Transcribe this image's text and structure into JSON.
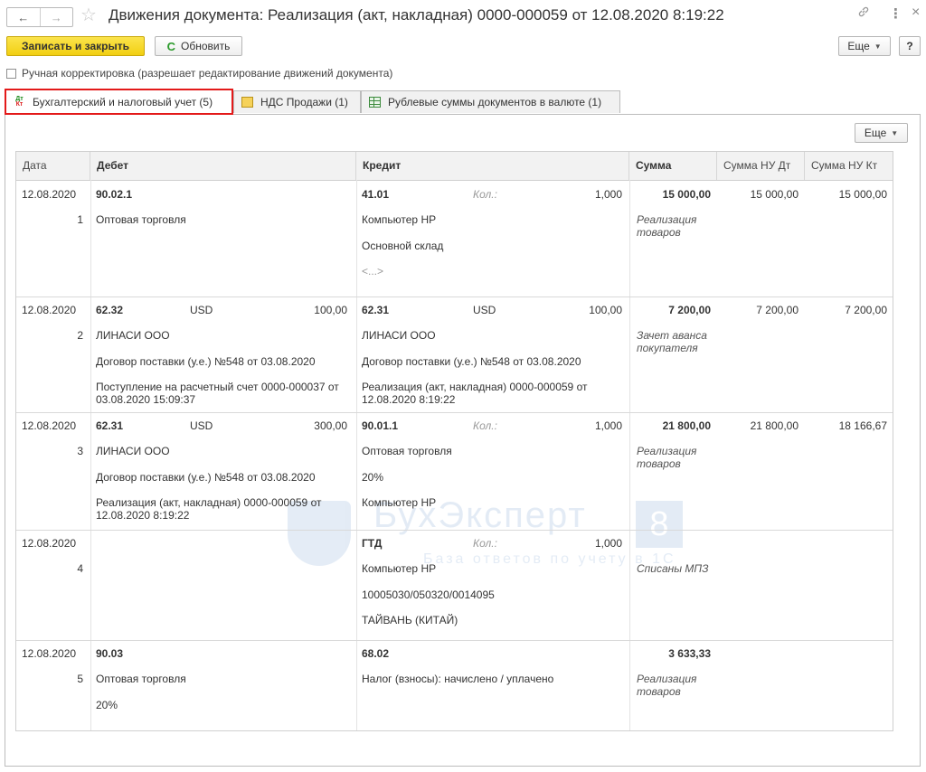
{
  "window": {
    "title": "Движения документа: Реализация (акт, накладная) 0000-000059 от 12.08.2020 8:19:22",
    "back_glyph": "←",
    "forward_glyph": "→",
    "star_glyph": "☆",
    "link_glyph": "🔗",
    "more_glyph": "⋮",
    "close_glyph": "×"
  },
  "toolbar": {
    "save_close_label": "Записать и закрыть",
    "refresh_label": "Обновить",
    "refresh_glyph": "C",
    "more_label": "Еще",
    "help_label": "?",
    "caret": "▼"
  },
  "manual_edit": {
    "label": "Ручная корректировка (разрешает редактирование движений документа)",
    "checked": false
  },
  "tabs": [
    {
      "label": "Бухгалтерский и налоговый учет (5)",
      "icon": "dt-kt-icon",
      "active": true
    },
    {
      "label": "НДС Продажи (1)",
      "icon": "vat-register-icon",
      "active": false
    },
    {
      "label": "Рублевые суммы документов в валюте (1)",
      "icon": "grid-icon",
      "active": false
    }
  ],
  "tab_icon_text": {
    "top": "Дт",
    "bottom": "Кт"
  },
  "table_more_label": "Еще",
  "columns": {
    "date": "Дата",
    "debet": "Дебет",
    "kredit": "Кредит",
    "sum": "Сумма",
    "nu_dt": "Сумма НУ Дт",
    "nu_kt": "Сумма НУ Кт"
  },
  "rows": [
    {
      "date": "12.08.2020",
      "num": "1",
      "debet_account": "90.02.1",
      "debet_currency": "",
      "debet_amount": "",
      "debet_lines": [
        "Оптовая торговля",
        "",
        ""
      ],
      "kredit_account": "41.01",
      "kredit_qty_label": "Кол.:",
      "kredit_qty": "1,000",
      "kredit_currency": "",
      "kredit_amount": "",
      "kredit_lines": [
        "Компьютер HP",
        "Основной склад",
        "<...>"
      ],
      "sum": "15 000,00",
      "content": "Реализация товаров",
      "nu_dt": "15 000,00",
      "nu_kt": "15 000,00"
    },
    {
      "date": "12.08.2020",
      "num": "2",
      "debet_account": "62.32",
      "debet_currency": "USD",
      "debet_amount": "100,00",
      "debet_lines": [
        "ЛИНАСИ ООО",
        "Договор поставки (у.е.) №548 от 03.08.2020",
        "Поступление на расчетный счет 0000-000037 от 03.08.2020 15:09:37"
      ],
      "kredit_account": "62.31",
      "kredit_qty_label": "",
      "kredit_qty": "",
      "kredit_currency": "USD",
      "kredit_amount": "100,00",
      "kredit_lines": [
        "ЛИНАСИ ООО",
        "Договор поставки (у.е.) №548 от 03.08.2020",
        "Реализация (акт, накладная) 0000-000059 от 12.08.2020 8:19:22"
      ],
      "sum": "7 200,00",
      "content": "Зачет аванса покупателя",
      "nu_dt": "7 200,00",
      "nu_kt": "7 200,00"
    },
    {
      "date": "12.08.2020",
      "num": "3",
      "debet_account": "62.31",
      "debet_currency": "USD",
      "debet_amount": "300,00",
      "debet_lines": [
        "ЛИНАСИ ООО",
        "Договор поставки (у.е.) №548 от 03.08.2020",
        "Реализация (акт, накладная) 0000-000059 от 12.08.2020 8:19:22"
      ],
      "kredit_account": "90.01.1",
      "kredit_qty_label": "Кол.:",
      "kredit_qty": "1,000",
      "kredit_currency": "",
      "kredit_amount": "",
      "kredit_lines": [
        "Оптовая торговля",
        "20%",
        "Компьютер HP"
      ],
      "sum": "21 800,00",
      "content": "Реализация товаров",
      "nu_dt": "21 800,00",
      "nu_kt": "18 166,67"
    },
    {
      "date": "12.08.2020",
      "num": "4",
      "debet_account": "",
      "debet_currency": "",
      "debet_amount": "",
      "debet_lines": [
        "",
        "",
        ""
      ],
      "kredit_account": "ГТД",
      "kredit_qty_label": "Кол.:",
      "kredit_qty": "1,000",
      "kredit_currency": "",
      "kredit_amount": "",
      "kredit_lines": [
        "Компьютер HP",
        "10005030/050320/0014095",
        "ТАЙВАНЬ (КИТАЙ)"
      ],
      "sum": "",
      "content": "Списаны МПЗ",
      "nu_dt": "",
      "nu_kt": ""
    },
    {
      "date": "12.08.2020",
      "num": "5",
      "debet_account": "90.03",
      "debet_currency": "",
      "debet_amount": "",
      "debet_lines": [
        "Оптовая торговля",
        "20%",
        ""
      ],
      "kredit_account": "68.02",
      "kredit_qty_label": "",
      "kredit_qty": "",
      "kredit_currency": "",
      "kredit_amount": "",
      "kredit_lines": [
        "Налог (взносы): начислено / уплачено",
        "",
        ""
      ],
      "sum": "3 633,33",
      "content": "Реализация товаров",
      "nu_dt": "",
      "nu_kt": ""
    }
  ],
  "watermark": {
    "brand": "БухЭксперт",
    "badge": "8",
    "tagline": "База ответов по учету в 1С"
  }
}
